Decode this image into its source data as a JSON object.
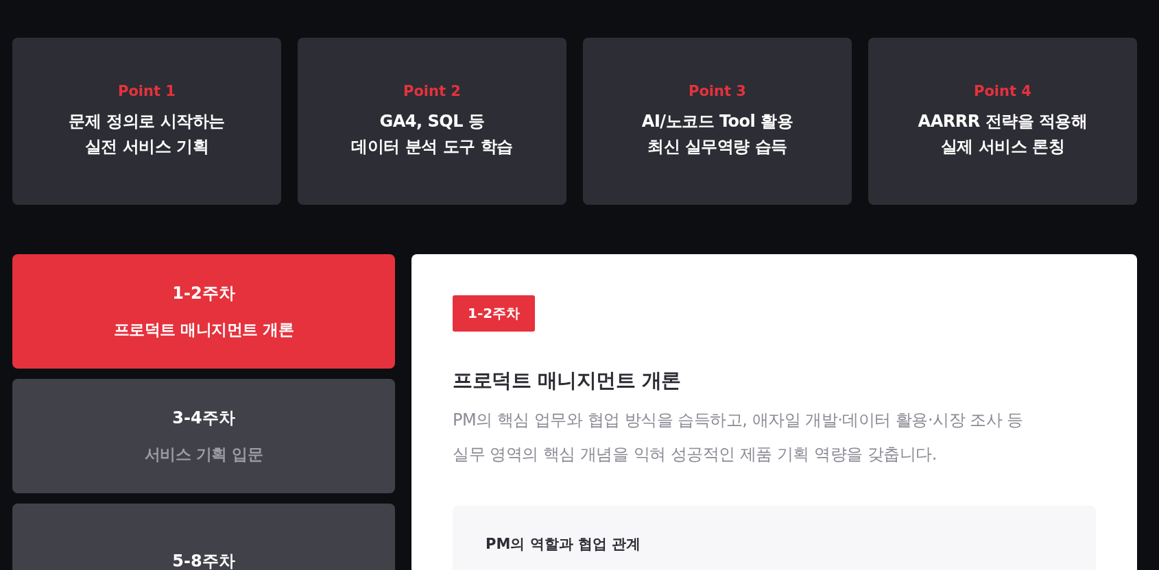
{
  "points": [
    {
      "label": "Point 1",
      "title": "문제 정의로 시작하는\n실전 서비스 기획"
    },
    {
      "label": "Point 2",
      "title": "GA4, SQL 등\n데이터 분석 도구 학습"
    },
    {
      "label": "Point 3",
      "title": "AI/노코드 Tool 활용\n최신 실무역량 습득"
    },
    {
      "label": "Point 4",
      "title": "AARRR 전략을 적용해\n실제 서비스 론칭"
    }
  ],
  "weeks": [
    {
      "week": "1-2주차",
      "title": "프로덕트 매니지먼트 개론",
      "selected": true
    },
    {
      "week": "3-4주차",
      "title": "서비스 기획 입문",
      "selected": false
    },
    {
      "week": "5-8주차",
      "selected": false
    }
  ],
  "detail": {
    "badge": "1-2주차",
    "title": "프로덕트 매니지먼트 개론",
    "description": "PM의 핵심 업무와 협업 방식을 습득하고, 애자일 개발·데이터 활용·시장 조사 등\n실무 영역의 핵심 개념을 익혀 성공적인 제품 기획 역량을 갖춥니다.",
    "topic": "PM의 역할과 협업 관계"
  }
}
